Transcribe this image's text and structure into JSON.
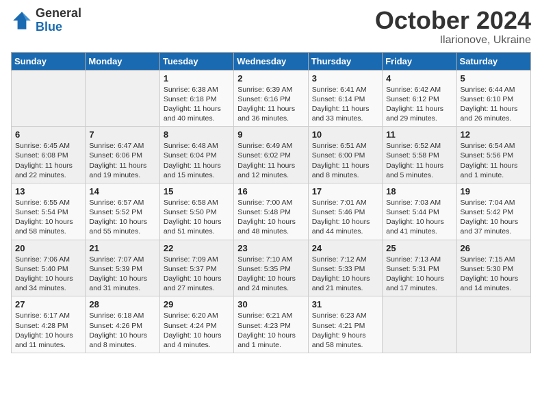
{
  "logo": {
    "general": "General",
    "blue": "Blue"
  },
  "header": {
    "month": "October 2024",
    "location": "Ilarionove, Ukraine"
  },
  "weekdays": [
    "Sunday",
    "Monday",
    "Tuesday",
    "Wednesday",
    "Thursday",
    "Friday",
    "Saturday"
  ],
  "weeks": [
    [
      {
        "day": "",
        "info": ""
      },
      {
        "day": "",
        "info": ""
      },
      {
        "day": "1",
        "info": "Sunrise: 6:38 AM\nSunset: 6:18 PM\nDaylight: 11 hours and 40 minutes."
      },
      {
        "day": "2",
        "info": "Sunrise: 6:39 AM\nSunset: 6:16 PM\nDaylight: 11 hours and 36 minutes."
      },
      {
        "day": "3",
        "info": "Sunrise: 6:41 AM\nSunset: 6:14 PM\nDaylight: 11 hours and 33 minutes."
      },
      {
        "day": "4",
        "info": "Sunrise: 6:42 AM\nSunset: 6:12 PM\nDaylight: 11 hours and 29 minutes."
      },
      {
        "day": "5",
        "info": "Sunrise: 6:44 AM\nSunset: 6:10 PM\nDaylight: 11 hours and 26 minutes."
      }
    ],
    [
      {
        "day": "6",
        "info": "Sunrise: 6:45 AM\nSunset: 6:08 PM\nDaylight: 11 hours and 22 minutes."
      },
      {
        "day": "7",
        "info": "Sunrise: 6:47 AM\nSunset: 6:06 PM\nDaylight: 11 hours and 19 minutes."
      },
      {
        "day": "8",
        "info": "Sunrise: 6:48 AM\nSunset: 6:04 PM\nDaylight: 11 hours and 15 minutes."
      },
      {
        "day": "9",
        "info": "Sunrise: 6:49 AM\nSunset: 6:02 PM\nDaylight: 11 hours and 12 minutes."
      },
      {
        "day": "10",
        "info": "Sunrise: 6:51 AM\nSunset: 6:00 PM\nDaylight: 11 hours and 8 minutes."
      },
      {
        "day": "11",
        "info": "Sunrise: 6:52 AM\nSunset: 5:58 PM\nDaylight: 11 hours and 5 minutes."
      },
      {
        "day": "12",
        "info": "Sunrise: 6:54 AM\nSunset: 5:56 PM\nDaylight: 11 hours and 1 minute."
      }
    ],
    [
      {
        "day": "13",
        "info": "Sunrise: 6:55 AM\nSunset: 5:54 PM\nDaylight: 10 hours and 58 minutes."
      },
      {
        "day": "14",
        "info": "Sunrise: 6:57 AM\nSunset: 5:52 PM\nDaylight: 10 hours and 55 minutes."
      },
      {
        "day": "15",
        "info": "Sunrise: 6:58 AM\nSunset: 5:50 PM\nDaylight: 10 hours and 51 minutes."
      },
      {
        "day": "16",
        "info": "Sunrise: 7:00 AM\nSunset: 5:48 PM\nDaylight: 10 hours and 48 minutes."
      },
      {
        "day": "17",
        "info": "Sunrise: 7:01 AM\nSunset: 5:46 PM\nDaylight: 10 hours and 44 minutes."
      },
      {
        "day": "18",
        "info": "Sunrise: 7:03 AM\nSunset: 5:44 PM\nDaylight: 10 hours and 41 minutes."
      },
      {
        "day": "19",
        "info": "Sunrise: 7:04 AM\nSunset: 5:42 PM\nDaylight: 10 hours and 37 minutes."
      }
    ],
    [
      {
        "day": "20",
        "info": "Sunrise: 7:06 AM\nSunset: 5:40 PM\nDaylight: 10 hours and 34 minutes."
      },
      {
        "day": "21",
        "info": "Sunrise: 7:07 AM\nSunset: 5:39 PM\nDaylight: 10 hours and 31 minutes."
      },
      {
        "day": "22",
        "info": "Sunrise: 7:09 AM\nSunset: 5:37 PM\nDaylight: 10 hours and 27 minutes."
      },
      {
        "day": "23",
        "info": "Sunrise: 7:10 AM\nSunset: 5:35 PM\nDaylight: 10 hours and 24 minutes."
      },
      {
        "day": "24",
        "info": "Sunrise: 7:12 AM\nSunset: 5:33 PM\nDaylight: 10 hours and 21 minutes."
      },
      {
        "day": "25",
        "info": "Sunrise: 7:13 AM\nSunset: 5:31 PM\nDaylight: 10 hours and 17 minutes."
      },
      {
        "day": "26",
        "info": "Sunrise: 7:15 AM\nSunset: 5:30 PM\nDaylight: 10 hours and 14 minutes."
      }
    ],
    [
      {
        "day": "27",
        "info": "Sunrise: 6:17 AM\nSunset: 4:28 PM\nDaylight: 10 hours and 11 minutes."
      },
      {
        "day": "28",
        "info": "Sunrise: 6:18 AM\nSunset: 4:26 PM\nDaylight: 10 hours and 8 minutes."
      },
      {
        "day": "29",
        "info": "Sunrise: 6:20 AM\nSunset: 4:24 PM\nDaylight: 10 hours and 4 minutes."
      },
      {
        "day": "30",
        "info": "Sunrise: 6:21 AM\nSunset: 4:23 PM\nDaylight: 10 hours and 1 minute."
      },
      {
        "day": "31",
        "info": "Sunrise: 6:23 AM\nSunset: 4:21 PM\nDaylight: 9 hours and 58 minutes."
      },
      {
        "day": "",
        "info": ""
      },
      {
        "day": "",
        "info": ""
      }
    ]
  ]
}
